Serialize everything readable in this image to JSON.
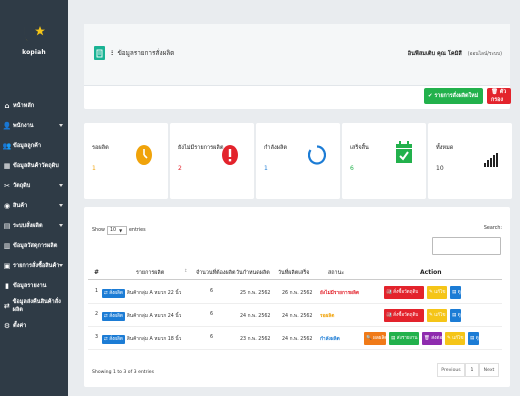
{
  "brand": {
    "name": "kopiah"
  },
  "sidebar": {
    "items": [
      {
        "label": "หน้าหลัก",
        "icon": "home-icon",
        "caret": false
      },
      {
        "label": "พนักงาน",
        "icon": "users-icon",
        "caret": true
      },
      {
        "label": "ข้อมูลลูกค้า",
        "icon": "customer-icon",
        "caret": false
      },
      {
        "label": "ข้อมูลสินค้าวัตถุดิบ",
        "icon": "product-icon",
        "caret": false
      },
      {
        "label": "วัตถุดิบ",
        "icon": "material-icon",
        "caret": true
      },
      {
        "label": "สินค้า",
        "icon": "goods-icon",
        "caret": true
      },
      {
        "label": "ระบบสั่งผลิต",
        "icon": "order-icon",
        "caret": true
      },
      {
        "label": "ข้อมูลวัสดุการผลิต",
        "icon": "production-icon",
        "caret": false
      },
      {
        "label": "รายการสั่งซื้อสินค้า",
        "icon": "purchase-icon",
        "caret": true
      },
      {
        "label": "ข้อมูลรายงาน",
        "icon": "report-icon",
        "caret": false
      },
      {
        "label": "ข้อมูลส่งคืนสินค้าสั่งผลิต",
        "icon": "exchange-icon",
        "caret": false
      },
      {
        "label": "ตั้งค่า",
        "icon": "settings-icon",
        "caret": false
      }
    ]
  },
  "header": {
    "title_prefix": "ⵗ",
    "title": "ข้อมูลรายการสั่งผลิต",
    "user": "อินฟีสมเติบ คุณ โคมิสี",
    "timestamp": "(ออนไลน์/ระบบ)",
    "btn_add": "✔ รายการสั่งผลิตใหม่",
    "btn_delete": "🗑 ตัวกรอง"
  },
  "cards": [
    {
      "label": "รอผลิต",
      "value": "1",
      "value_color": "#f0a30a",
      "icon": "clock-icon"
    },
    {
      "label": "ยังไม่มีรายการผลิต",
      "value": "2",
      "value_color": "#e3232c",
      "icon": "alert-icon"
    },
    {
      "label": "กำลังผลิต",
      "value": "1",
      "value_color": "#1c7cd5",
      "icon": "progress-icon"
    },
    {
      "label": "เสร็จสิ้น",
      "value": "6",
      "value_color": "#22b14c",
      "icon": "calendar-check-icon"
    },
    {
      "label": "ทั้งหมด",
      "value": "10",
      "value_color": "#333333",
      "icon": "signal-icon"
    }
  ],
  "table": {
    "show_prefix": "Show",
    "show_value": "10",
    "show_suffix": "entries",
    "search_label": "Search:",
    "headers": {
      "num": "#",
      "name": "รายการผลิต",
      "qty": "จำนวนที่ต้องผลิต",
      "start": "วันกำหนดผลิต",
      "end": "วันที่ผลิตเสร็จ",
      "status": "สถานะ",
      "action": "Action"
    },
    "rows": [
      {
        "num": "1",
        "badge": "⇄ สั่งผลิต",
        "name": "สินค้ากลุ่ม A หมวก 22 นิ้ว",
        "qty": "6",
        "start": "25 ก.พ. 2562",
        "end": "26 ก.พ. 2562",
        "status": "ยังไม่มีรายการผลิต",
        "status_color": "#e3232c",
        "actions": [
          {
            "label": "🏭 สั่งซื้อวัตถุดิบ",
            "color": "#e3232c",
            "w": 40
          },
          {
            "label": "✎ แก้ไข",
            "color": "#f5c518",
            "w": 20
          },
          {
            "label": "▤ ดู",
            "color": "#1c7cd5",
            "w": 11
          }
        ]
      },
      {
        "num": "2",
        "badge": "⇄ สั่งผลิต",
        "name": "สินค้ากลุ่ม A หมวก 24 นิ้ว",
        "qty": "6",
        "start": "24 ก.พ. 2562",
        "end": "24 ก.พ. 2562",
        "status": "รอผลิต",
        "status_color": "#f0a30a",
        "actions": [
          {
            "label": "🏭 สั่งซื้อวัตถุดิบ",
            "color": "#e3232c",
            "w": 40
          },
          {
            "label": "✎ แก้ไข",
            "color": "#f5c518",
            "w": 20
          },
          {
            "label": "▤ ดู",
            "color": "#1c7cd5",
            "w": 11
          }
        ]
      },
      {
        "num": "3",
        "badge": "⇄ สั่งผลิต",
        "name": "สินค้ากลุ่ม A หมวก 18 นิ้ว",
        "qty": "6",
        "start": "23 ก.พ. 2562",
        "end": "24 ก.พ. 2562",
        "status": "กำลังผลิต",
        "status_color": "#1c7cd5",
        "actions": [
          {
            "label": "🔍 ผลผลิต",
            "color": "#f07a18",
            "w": 22
          },
          {
            "label": "▤ ส่งรายงาน",
            "color": "#22b14c",
            "w": 30
          },
          {
            "label": "🗑 ส่งต่อ",
            "color": "#8e2cae",
            "w": 20
          },
          {
            "label": "✎ แก้ไข",
            "color": "#f5c518",
            "w": 20
          },
          {
            "label": "▤ ดู",
            "color": "#1c7cd5",
            "w": 11
          }
        ]
      }
    ],
    "footer": "Showing 1 to 3 of 3 entries",
    "pager": {
      "prev": "Previous",
      "page": "1",
      "next": "Next"
    }
  }
}
